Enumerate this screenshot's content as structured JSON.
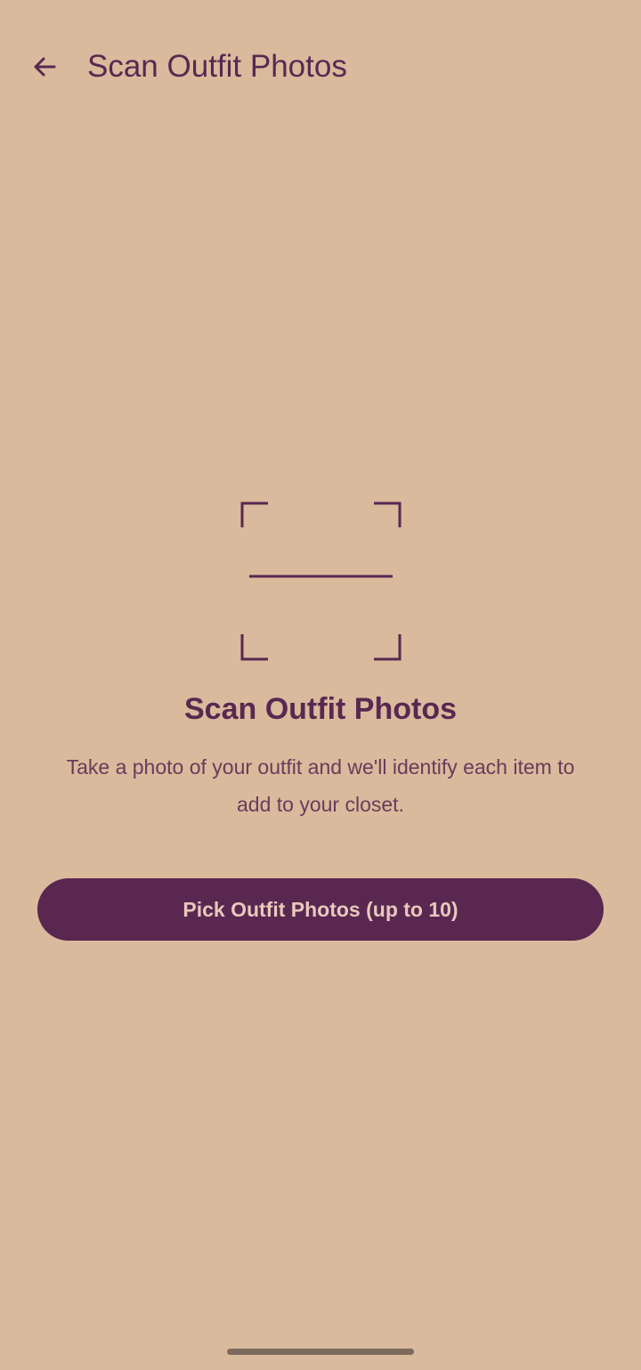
{
  "app_bar": {
    "back_icon": "arrow-back-icon",
    "title": "Scan Outfit Photos"
  },
  "empty_state": {
    "icon": "scan-frame-icon",
    "title": "Scan Outfit Photos",
    "description": "Take a photo of your outfit and we'll identify each item to add to your closet.",
    "button_label": "Pick Outfit Photos (up to 10)"
  },
  "colors": {
    "background": "#D9BA9C",
    "primary": "#5A2751",
    "description_text": "#6B3A5C",
    "button_text": "#E8C9BC",
    "home_indicator": "#7C6A5C"
  }
}
